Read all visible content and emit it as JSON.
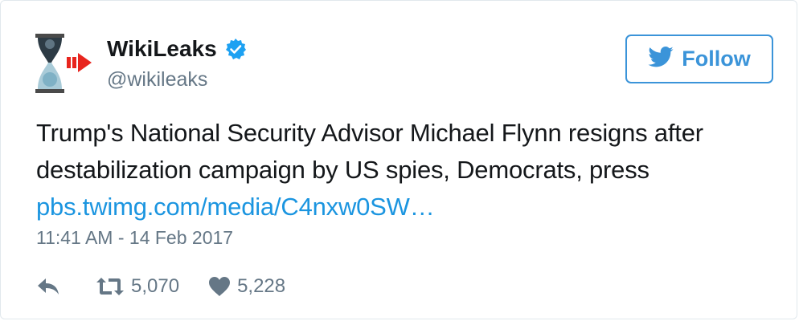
{
  "user": {
    "display_name": "WikiLeaks",
    "handle": "@wikileaks",
    "verified": true,
    "avatar_icon": "wikileaks-hourglass-logo"
  },
  "follow_button": {
    "label": "Follow",
    "icon": "twitter-bird-icon"
  },
  "tweet": {
    "text_line1": "Trump's National Security Advisor Michael Flynn resigns after",
    "text_line2": "destabilization campaign by US spies, Democrats, press",
    "link_text": "pbs.twimg.com/media/C4nxw0SW…",
    "timestamp": "11:41 AM - 14 Feb 2017"
  },
  "actions": {
    "reply_icon": "reply-icon",
    "retweet_icon": "retweet-icon",
    "retweet_count": "5,070",
    "like_icon": "heart-icon",
    "like_count": "5,228"
  },
  "colors": {
    "text": "#14171a",
    "secondary": "#657786",
    "link": "#1b95e0",
    "follow_accent": "#3b94d9",
    "verified": "#1da1f2"
  }
}
